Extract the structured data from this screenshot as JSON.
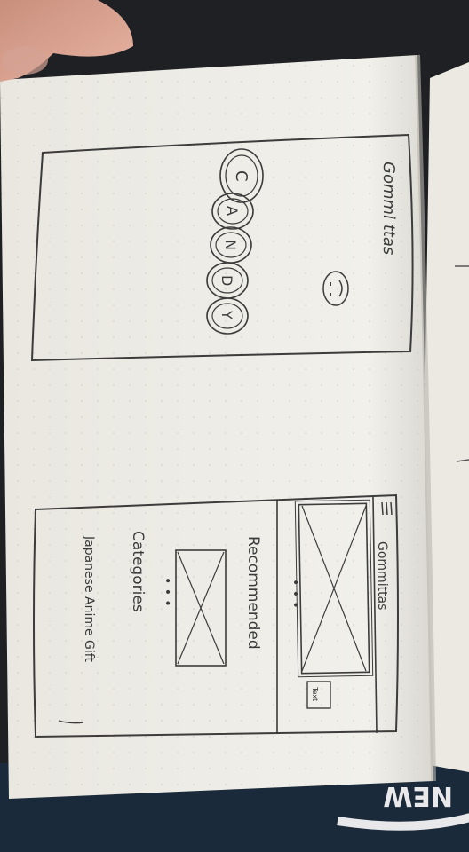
{
  "splash_sketch": {
    "title": "Gommi ttas",
    "letters": [
      "C",
      "A",
      "N",
      "D",
      "Y"
    ]
  },
  "home_sketch": {
    "menu_icon": "hamburger-menu-icon",
    "header_title": "Gommittas",
    "banner_tag": "Text",
    "recommended_label": "Recommended",
    "categories_label": "Categories",
    "category_item": "Japanese Anime Gift",
    "pager_dots": "• • •"
  },
  "background": {
    "shirt_text": "NEW"
  }
}
